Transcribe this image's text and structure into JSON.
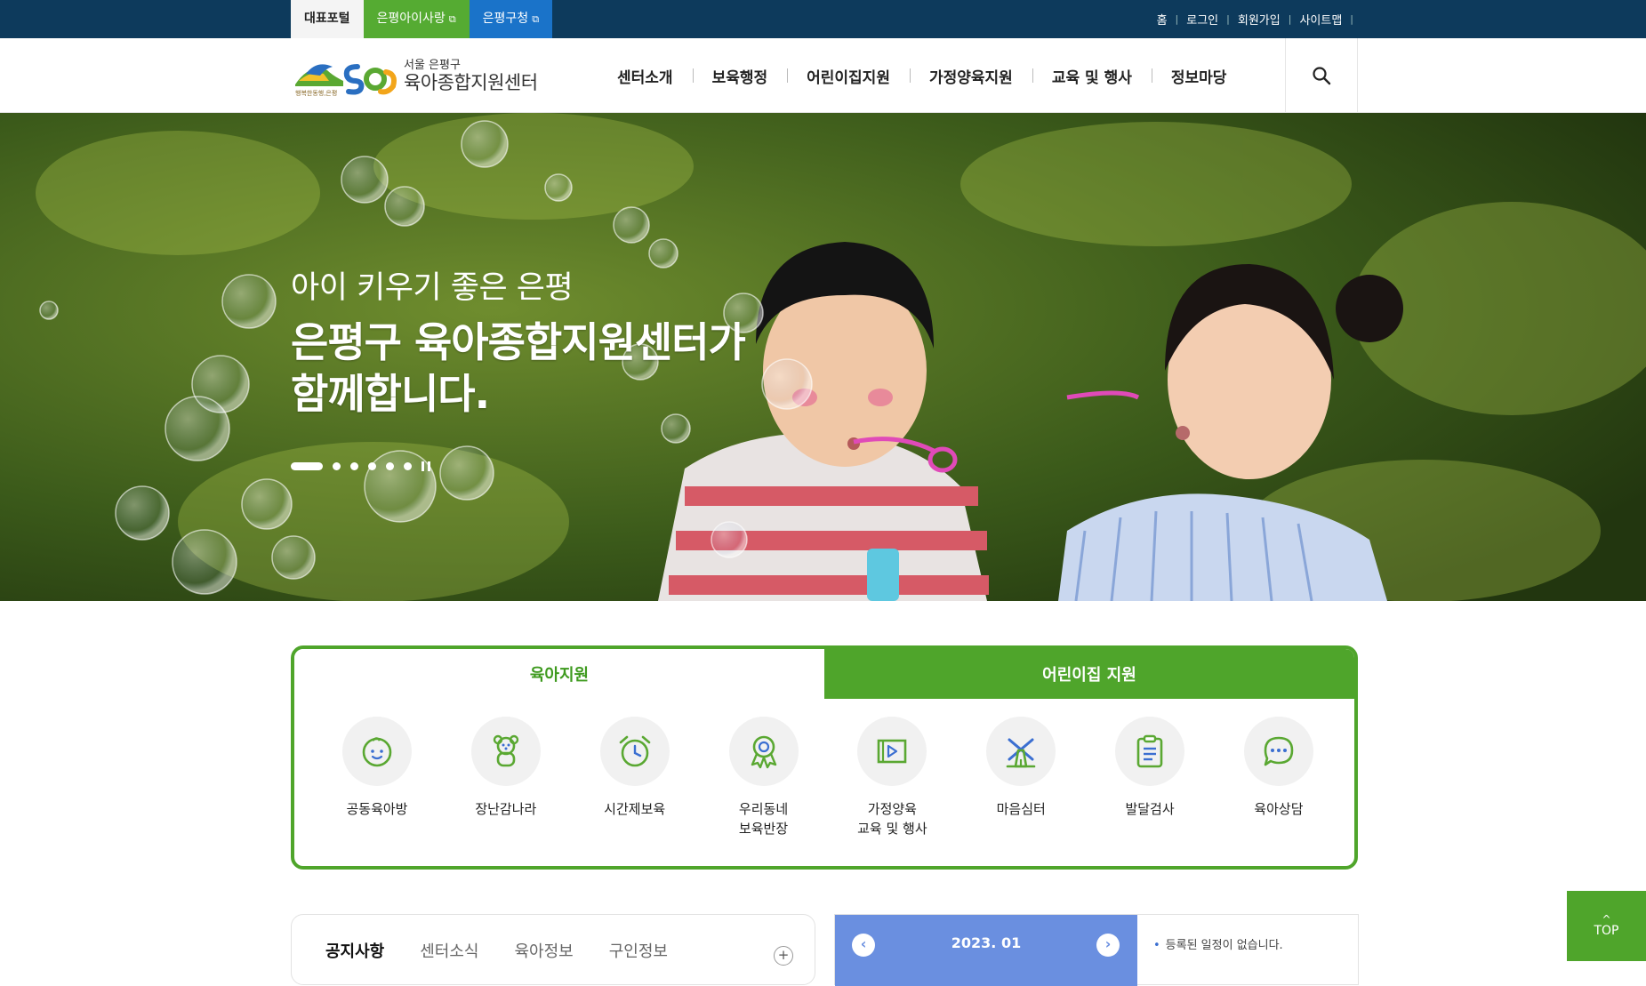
{
  "topbar": {
    "portal_tabs": [
      {
        "label": "대표포털"
      },
      {
        "label": "은평아이사랑"
      },
      {
        "label": "은평구청"
      }
    ],
    "links": [
      {
        "label": "홈"
      },
      {
        "label": "로그인"
      },
      {
        "label": "회원가입"
      },
      {
        "label": "사이트맵"
      }
    ],
    "colors": {
      "bar": "#0d3a5c",
      "green": "#55ab32",
      "blue": "#1a73c9"
    }
  },
  "header": {
    "logo_sub": "서울 은평구",
    "logo_main": "육아종합지원센터",
    "logo_tagline": "행복한동행,은평",
    "nav": [
      {
        "label": "센터소개"
      },
      {
        "label": "보육행정"
      },
      {
        "label": "어린이집지원"
      },
      {
        "label": "가정양육지원"
      },
      {
        "label": "교육 및 행사"
      },
      {
        "label": "정보마당"
      }
    ],
    "search_icon": "search-icon"
  },
  "hero": {
    "subtitle": "아이 키우기 좋은 은평",
    "title_line1": "은평구 육아종합지원센터가",
    "title_line2": "함께합니다.",
    "slide_count": 6,
    "active_slide": 1
  },
  "support": {
    "tabs": [
      {
        "label": "육아지원",
        "active": true
      },
      {
        "label": "어린이집 지원",
        "active": false
      }
    ],
    "items": [
      {
        "label": "공동육아방",
        "icon": "baby-face-icon"
      },
      {
        "label": "장난감나라",
        "icon": "teddy-bear-icon"
      },
      {
        "label": "시간제보육",
        "icon": "alarm-clock-icon"
      },
      {
        "label": "우리동네\n보육반장",
        "icon": "badge-icon"
      },
      {
        "label": "가정양육\n교육 및 행사",
        "icon": "video-play-icon"
      },
      {
        "label": "마음심터",
        "icon": "windmill-icon"
      },
      {
        "label": "발달검사",
        "icon": "clipboard-icon"
      },
      {
        "label": "육아상담",
        "icon": "chat-bubble-icon"
      }
    ],
    "accent_color": "#4fa52b"
  },
  "news": {
    "tabs": [
      {
        "label": "공지사항",
        "active": true
      },
      {
        "label": "센터소식"
      },
      {
        "label": "육아정보"
      },
      {
        "label": "구인정보"
      }
    ],
    "more_label": "+"
  },
  "calendar": {
    "month": "2023. 01",
    "prev_label": "‹",
    "next_label": "›",
    "empty_message": "등록된 일정이 없습니다.",
    "header_color": "#6a8fe0"
  },
  "top_button": {
    "label": "TOP",
    "arrow": "^"
  }
}
